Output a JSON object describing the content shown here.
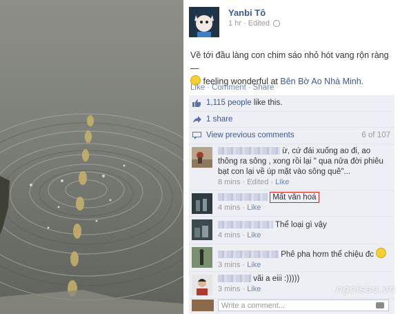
{
  "post": {
    "author": "Yanbi Tô",
    "time": "1 hr",
    "edited": "Edited",
    "text": "Về tới đầu làng con chim sáo nhỏ hót vang rộn ràng —",
    "feeling": "feeling wonderful at",
    "place": "Bên Bờ Ao Nhà Minh."
  },
  "actions": {
    "like": "Like",
    "comment": "Comment",
    "share": "Share"
  },
  "ufi": {
    "likes_link": "1,115 people",
    "likes_suffix": "like this.",
    "shares": "1 share",
    "view_previous": "View previous comments",
    "count": "6 of 107"
  },
  "comments": [
    {
      "text": "ừ, cứ đái xuống ao đi, ao thông ra sông , xong rồi lại \" qua nửa đời phiêu bạt con lại về úp mặt vào sông quê\"...",
      "time": "8 mins",
      "edited": "Edited",
      "like": "Like"
    },
    {
      "text": "Mất văn hoá",
      "time": "4 mins",
      "like": "Like"
    },
    {
      "text": "Thể loại gì vậy",
      "time": "4 mins",
      "like": "Like"
    },
    {
      "text": "Phê pha hơm thể chiệu đc",
      "time": "3 mins",
      "like": "Like"
    },
    {
      "text": "vãi a eiii :)))))",
      "time": "3 mins",
      "like": "Like"
    }
  ],
  "write_placeholder": "Write a comment...",
  "watermark": "ngoisao.vn",
  "colors": {
    "link": "#3b5998",
    "ufi_bg": "#edeff4",
    "highlight_border": "#dd2222"
  }
}
